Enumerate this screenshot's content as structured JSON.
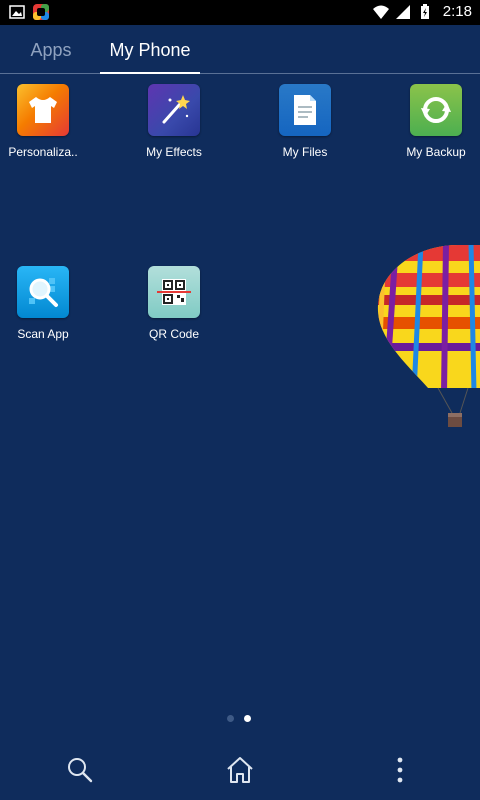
{
  "status_bar": {
    "time": "2:18",
    "icons": [
      "image-notification-icon",
      "app-notification-icon",
      "wifi-icon",
      "signal-icon",
      "battery-icon"
    ]
  },
  "tabs": [
    {
      "label": "Apps",
      "active": false
    },
    {
      "label": "My Phone",
      "active": true
    }
  ],
  "apps": [
    {
      "label": "Personaliza..",
      "icon": "shirt-icon"
    },
    {
      "label": "My Effects",
      "icon": "magic-wand-icon"
    },
    {
      "label": "My Files",
      "icon": "document-icon"
    },
    {
      "label": "My Backup",
      "icon": "sync-icon"
    },
    {
      "label": "Scan App",
      "icon": "magnifier-icon"
    },
    {
      "label": "QR Code",
      "icon": "qr-code-icon"
    }
  ],
  "pagination": {
    "current": 2,
    "total": 2
  },
  "bottom_nav": [
    "search-icon",
    "home-icon",
    "more-vert-icon"
  ],
  "colors": {
    "background": "#0f2c5c",
    "status_bar": "#000000",
    "active_tab": "#ffffff",
    "inactive_tab": "#8fa2bf"
  }
}
